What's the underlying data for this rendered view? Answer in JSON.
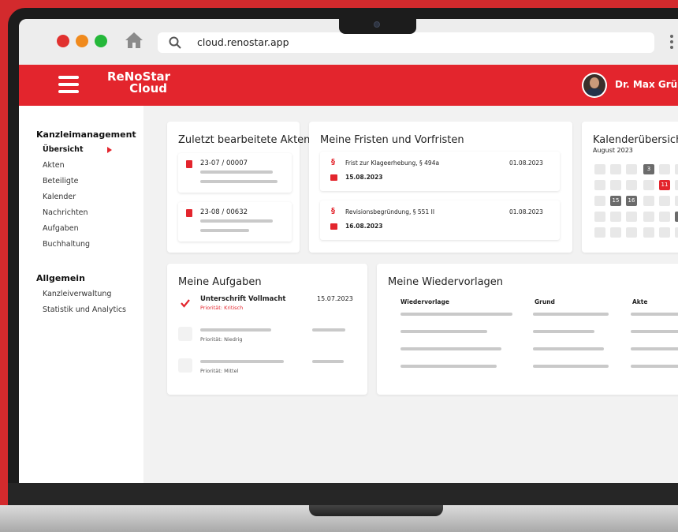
{
  "browser": {
    "url": "cloud.renostar.app"
  },
  "app": {
    "logo_line1": "ReNoStar",
    "logo_line2": "Cloud",
    "user_name": "Dr. Max Gründl",
    "accent": "#e3252d"
  },
  "sidebar": {
    "section1_title": "Kanzleimanagement",
    "section1_items": [
      "Übersicht",
      "Akten",
      "Beteiligte",
      "Kalender",
      "Nachrichten",
      "Aufgaben",
      "Buchhaltung"
    ],
    "section2_title": "Allgemein",
    "section2_items": [
      "Kanzleiverwaltung",
      "Statistik und Analytics"
    ]
  },
  "akten": {
    "title": "Zuletzt bearbeitete Akten",
    "items": [
      "23-07 / 00007",
      "23-08 / 00632"
    ]
  },
  "fristen": {
    "title": "Meine Fristen und Vorfristen",
    "items": [
      {
        "text": "Frist zur Klageerhebung, § 494a",
        "date": "01.08.2023",
        "deadline": "15.08.2023"
      },
      {
        "text": "Revisionsbegründung, § 551 II",
        "date": "01.08.2023",
        "deadline": "16.08.2023"
      }
    ]
  },
  "kalender": {
    "title": "Kalenderübersicht",
    "month": "August 2023",
    "day_3": "3",
    "day_11": "11",
    "day_15": "15",
    "day_16": "16"
  },
  "aufgaben": {
    "title": "Meine Aufgaben",
    "task1_title": "Unterschrift Vollmacht",
    "task1_prio": "Priorität: Kritisch",
    "task1_date": "15.07.2023",
    "task2_prio": "Priorität: Niedrig",
    "task3_prio": "Priorität: Mittel"
  },
  "wiedervorlagen": {
    "title": "Meine Wiedervorlagen",
    "columns": [
      "Wiedervorlage",
      "Grund",
      "Akte"
    ]
  }
}
